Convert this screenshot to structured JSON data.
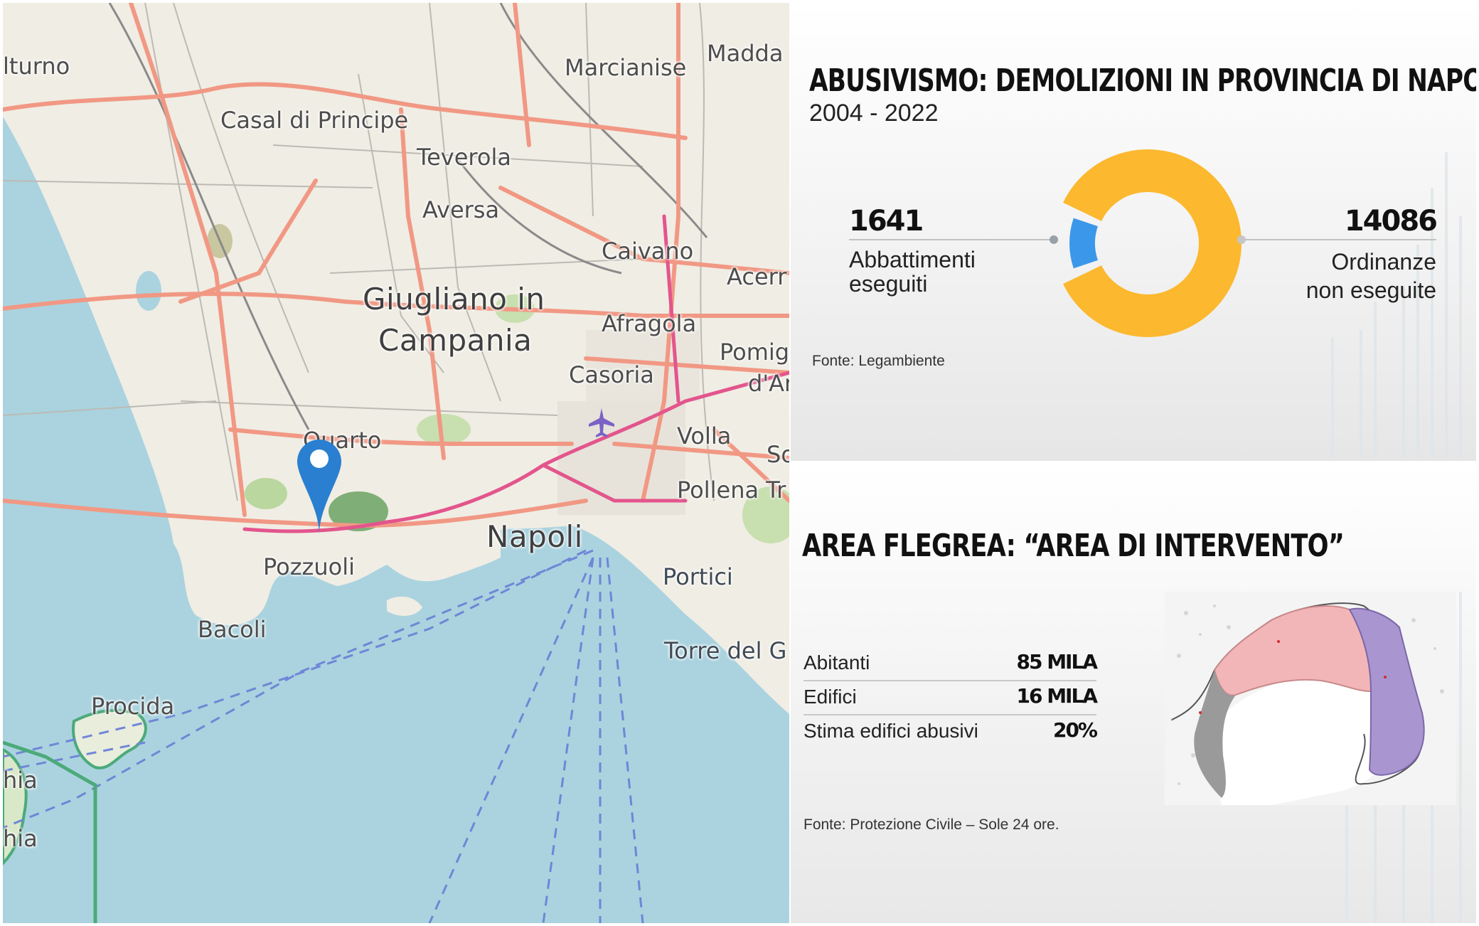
{
  "map": {
    "places": [
      {
        "name": "lturno"
      },
      {
        "name": "Marcianise"
      },
      {
        "name": "Madda"
      },
      {
        "name": "Casal di Principe"
      },
      {
        "name": "Teverola"
      },
      {
        "name": "Aversa"
      },
      {
        "name": "Caivano"
      },
      {
        "name": "Acerr"
      },
      {
        "name": "Giugliano in"
      },
      {
        "name": "Campania"
      },
      {
        "name": "Afragola"
      },
      {
        "name": "Pomig"
      },
      {
        "name": "d'Ar"
      },
      {
        "name": "Casoria"
      },
      {
        "name": "Quarto"
      },
      {
        "name": "Volla"
      },
      {
        "name": "So"
      },
      {
        "name": "Pollena Tr"
      },
      {
        "name": "Napoli"
      },
      {
        "name": "Pozzuoli"
      },
      {
        "name": "Portici"
      },
      {
        "name": "Bacoli"
      },
      {
        "name": "Torre del G"
      },
      {
        "name": "Procida"
      },
      {
        "name": "hia"
      },
      {
        "name": "hia"
      }
    ],
    "marker_icon": "map-pin-icon",
    "airport_icon": "airplane-icon",
    "colors": {
      "sea": "#aad3df",
      "land": "#f0ede4",
      "road": "#f19884",
      "park": "#c8dfb0",
      "marker": "#2a7fd0"
    }
  },
  "infographic_demolitions": {
    "title": "ABUSIVISMO: DEMOLIZIONI IN PROVINCIA DI NAPOLI",
    "period": "2004 - 2022",
    "left_value": "1641",
    "left_label_1": "Abbattimenti",
    "left_label_2": "eseguiti",
    "right_value": "14086",
    "right_label_1": "Ordinanze",
    "right_label_2": "non eseguite",
    "source": "Fonte: Legambiente",
    "colors": {
      "executed": "#3b97ea",
      "not_executed": "#fcb82e"
    }
  },
  "chart_data": {
    "type": "pie",
    "categories": [
      "Abbattimenti eseguiti",
      "Ordinanze non eseguite"
    ],
    "values": [
      1641,
      14086
    ],
    "title": "ABUSIVISMO: DEMOLIZIONI IN PROVINCIA DI NAPOLI",
    "subtitle": "2004 - 2022",
    "donut": true,
    "colors": [
      "#3b97ea",
      "#fcb82e"
    ]
  },
  "infographic_area": {
    "title": "AREA FLEGREA: “AREA DI INTERVENTO”",
    "rows": [
      {
        "label": "Abitanti",
        "value": "85 MILA"
      },
      {
        "label": "Edifici",
        "value": "16 MILA"
      },
      {
        "label": "Stima edifici abusivi",
        "value": "20%"
      }
    ],
    "source": "Fonte: Protezione Civile – Sole 24 ore.",
    "map_colors": {
      "zone_red": "#f3b6b8",
      "zone_purple": "#a996d1",
      "zone_grey": "#9a9a9a"
    }
  }
}
